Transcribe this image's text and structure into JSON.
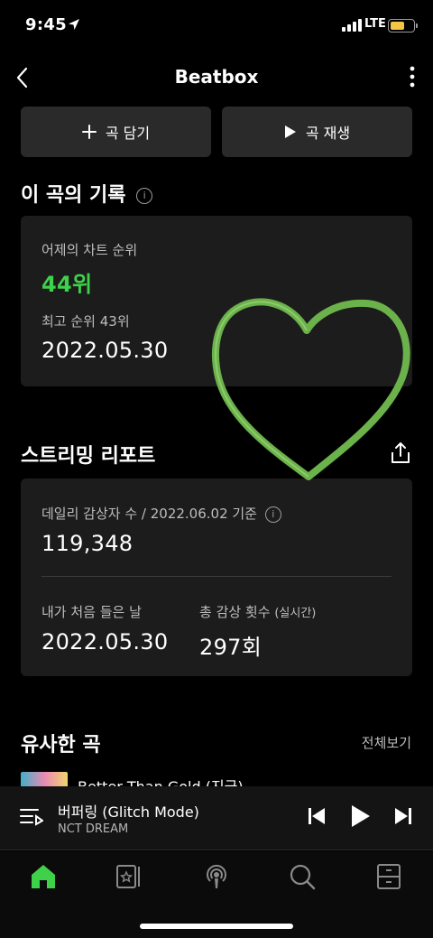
{
  "status": {
    "time": "9:45",
    "network": "LTE",
    "battery_level": 0.65,
    "battery_color": "#f4c542"
  },
  "header": {
    "title": "Beatbox",
    "back_icon": "chevron-left-icon",
    "more_icon": "vertical-dots-icon"
  },
  "actions": {
    "add_label": "곡 담기",
    "play_label": "곡 재생"
  },
  "record": {
    "title": "이 곡의 기록",
    "yesterday_label": "어제의 차트 순위",
    "yesterday_rank": "44위",
    "best_label": "최고 순위 43위",
    "best_date": "2022.05.30",
    "accent": "#3fd14a"
  },
  "report": {
    "title": "스트리밍 리포트",
    "daily_label": "데일리 감상자 수 / 2022.06.02 기준",
    "daily_value": "119,348",
    "first_listen_label": "내가 처음 들은 날",
    "first_listen_value": "2022.05.30",
    "total_plays_label": "총 감상 횟수",
    "total_plays_suffix": "(실시간)",
    "total_plays_value": "297회"
  },
  "similar": {
    "title": "유사한 곡",
    "see_all": "전체보기",
    "partial_song": "Better Than Gold (지금)"
  },
  "now_playing": {
    "title": "버퍼링 (Glitch Mode)",
    "artist": "NCT DREAM"
  },
  "tabs": [
    {
      "icon": "home-icon",
      "active": true
    },
    {
      "icon": "library-icon",
      "active": false
    },
    {
      "icon": "podcast-icon",
      "active": false
    },
    {
      "icon": "search-icon",
      "active": false
    },
    {
      "icon": "storage-icon",
      "active": false
    }
  ],
  "decoration": {
    "heart_color": "#6bb24a"
  }
}
